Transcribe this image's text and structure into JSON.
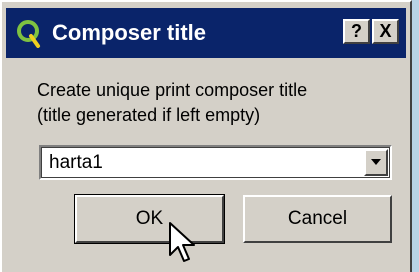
{
  "window": {
    "title": "Composer title",
    "help_button": "?",
    "close_button": "X"
  },
  "dialog": {
    "prompt_line1": "Create unique print composer title",
    "prompt_line2": "(title generated if left empty)",
    "combo_value": "harta1",
    "ok_label": "OK",
    "cancel_label": "Cancel"
  },
  "colors": {
    "titlebar": "#0a246a",
    "face": "#d4d0c8",
    "desktop": "#b8d3e6"
  },
  "icons": {
    "app": "qgis-icon",
    "dropdown": "chevron-down-icon",
    "pointer": "mouse-cursor-icon"
  }
}
